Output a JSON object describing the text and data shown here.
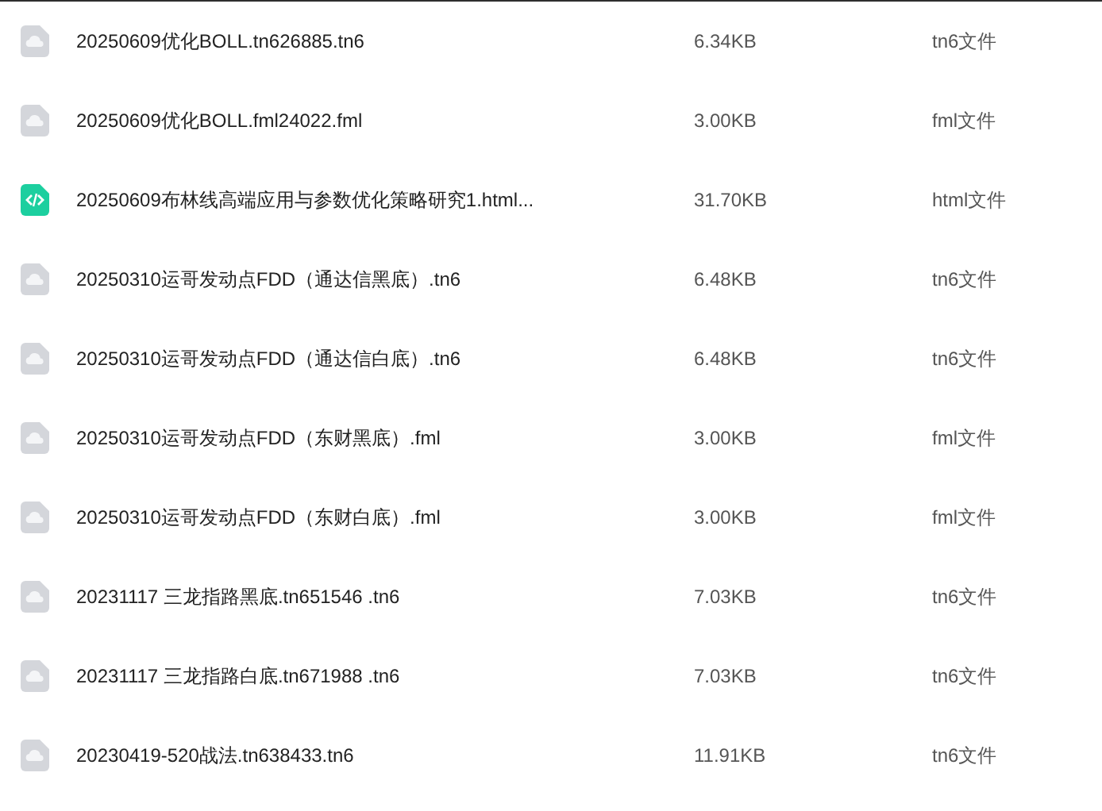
{
  "files": [
    {
      "kind": "generic",
      "name": "20250609优化BOLL.tn626885.tn6",
      "size": "6.34KB",
      "type": "tn6文件"
    },
    {
      "kind": "generic",
      "name": "20250609优化BOLL.fml24022.fml",
      "size": "3.00KB",
      "type": "fml文件"
    },
    {
      "kind": "code",
      "name": "20250609布林线高端应用与参数优化策略研究1.html...",
      "size": "31.70KB",
      "type": "html文件"
    },
    {
      "kind": "generic",
      "name": "20250310运哥发动点FDD（通达信黑底）.tn6",
      "size": "6.48KB",
      "type": "tn6文件"
    },
    {
      "kind": "generic",
      "name": "20250310运哥发动点FDD（通达信白底）.tn6",
      "size": "6.48KB",
      "type": "tn6文件"
    },
    {
      "kind": "generic",
      "name": "20250310运哥发动点FDD（东财黑底）.fml",
      "size": "3.00KB",
      "type": "fml文件"
    },
    {
      "kind": "generic",
      "name": "20250310运哥发动点FDD（东财白底）.fml",
      "size": "3.00KB",
      "type": "fml文件"
    },
    {
      "kind": "generic",
      "name": "20231117 三龙指路黑底.tn651546 .tn6",
      "size": "7.03KB",
      "type": "tn6文件"
    },
    {
      "kind": "generic",
      "name": "20231117 三龙指路白底.tn671988 .tn6",
      "size": "7.03KB",
      "type": "tn6文件"
    },
    {
      "kind": "generic",
      "name": "20230419-520战法.tn638433.tn6",
      "size": "11.91KB",
      "type": "tn6文件"
    }
  ]
}
